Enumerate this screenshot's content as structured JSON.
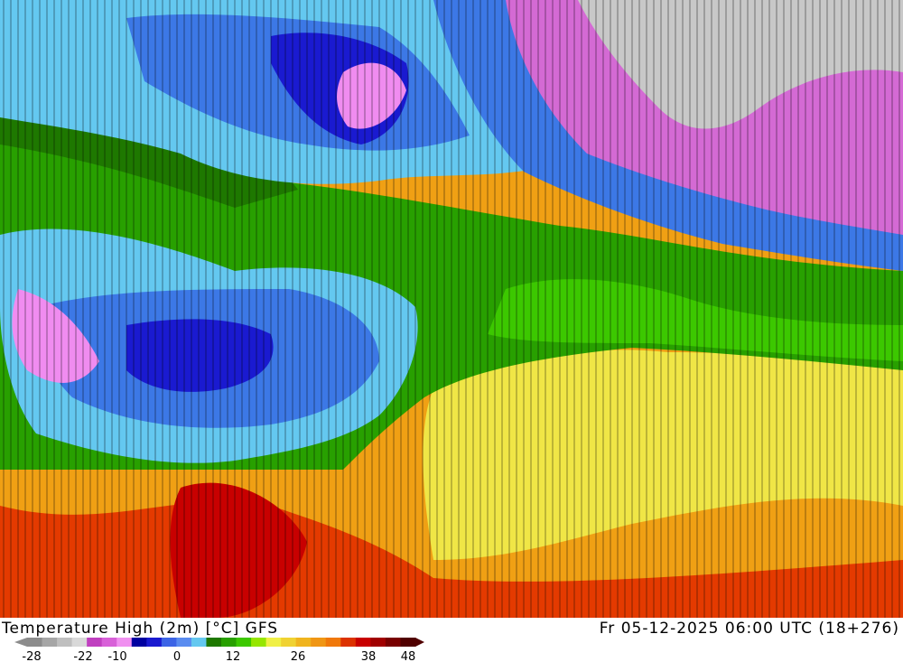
{
  "header": {
    "title": "Temperature High (2m) [°C] GFS",
    "valid_time": "Fr 05-12-2025 06:00 UTC (18+276)"
  },
  "legend": {
    "tick_labels": [
      "-28",
      "-22",
      "-10",
      "0",
      "12",
      "26",
      "38",
      "48"
    ],
    "colors": [
      "#8c8c8c",
      "#a6a6a6",
      "#bfbfbf",
      "#d9d9d9",
      "#c040c0",
      "#d860d8",
      "#f090f0",
      "#0000a0",
      "#1a1ad0",
      "#3c64e6",
      "#5a8cf0",
      "#64c8f0",
      "#1e7800",
      "#28a000",
      "#3cc800",
      "#96e600",
      "#f0f046",
      "#f0d232",
      "#f0b41e",
      "#f09614",
      "#f0780a",
      "#dc3200",
      "#c80000",
      "#a00000",
      "#780000",
      "#500000"
    ]
  },
  "map": {
    "description_icons": [
      "temperature-field",
      "contour-labels"
    ],
    "band_colors": {
      "cold_grey": "#c8c8c8",
      "magenta": "#d46ad4",
      "pink": "#f08cf0",
      "dark_blue": "#1a1ad0",
      "blue": "#3c78e6",
      "light_blue": "#64c8f0",
      "dark_green": "#1e7800",
      "green": "#28a000",
      "light_green": "#3cc800",
      "yellow": "#f0e646",
      "orange": "#f0a014",
      "red": "#dc2800"
    }
  }
}
